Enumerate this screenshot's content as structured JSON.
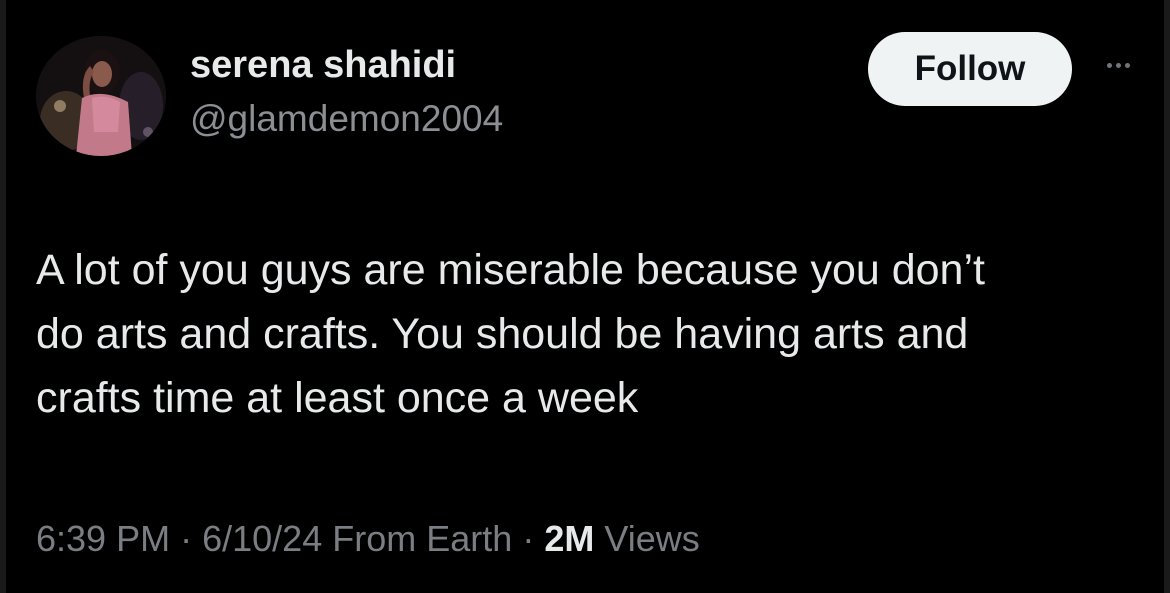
{
  "author": {
    "display_name": "serena shahidi",
    "handle": "@glamdemon2004"
  },
  "actions": {
    "follow_label": "Follow",
    "more_icon": "more-horizontal-icon"
  },
  "tweet": {
    "text_lines": [
      "A lot of you guys are miserable because you don’t",
      "do arts and crafts. You should be having arts and",
      "crafts time at least once a week"
    ]
  },
  "meta": {
    "time": "6:39 PM",
    "separator": "·",
    "date": "6/10/24",
    "location": "From Earth",
    "views_count": "2M",
    "views_label": "Views"
  },
  "colors": {
    "background": "#000000",
    "text_primary": "#e7e9ea",
    "text_secondary": "#8b8f93",
    "follow_button_bg": "#eff3f4",
    "follow_button_text": "#0f1419"
  }
}
